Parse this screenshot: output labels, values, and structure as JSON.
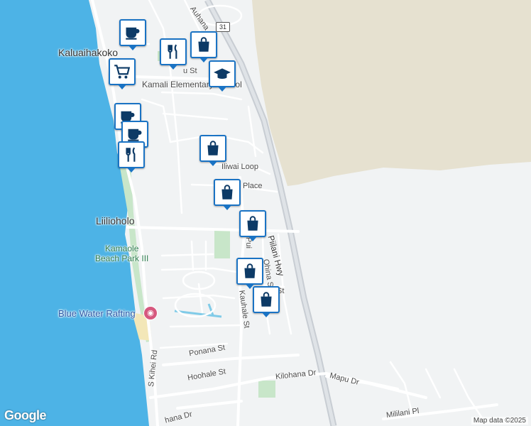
{
  "map": {
    "places": {
      "kaluaihakoko": "Kaluaihakoko",
      "liilioholo": "Liilioholo"
    },
    "poi": {
      "school": "Kamali  Elementary School",
      "park": "Kamaole\nBeach Park III",
      "rafting": "Blue Water Rafting"
    },
    "roads": {
      "auhana": "Auhana",
      "u_st": "u St",
      "iliwai": "Iliwai Loop",
      "place": "Place",
      "piilani": "Piilani Hwy",
      "pui": "Pui",
      "ohina": "Ohina St",
      "st": "St",
      "kauhale": "Kauhale St",
      "s_kihei": "S Kihei Rd",
      "ponana": "Ponana St",
      "hoohale": "Hoohale St",
      "kilohana": "Kilohana Dr",
      "mapu": "Mapu Dr",
      "mililani": "Mililani Pl",
      "bottom_dr": "hana Dr"
    },
    "route_shield": "31",
    "colors": {
      "water": "#4db3e6",
      "land": "#f1f3f4",
      "mountain": "#e6e1d0",
      "park": "#c8e6c9",
      "marker": "#1a73c4"
    }
  },
  "markers": [
    {
      "icon": "coffee-icon"
    },
    {
      "icon": "restaurant-icon"
    },
    {
      "icon": "shopping-bag-icon"
    },
    {
      "icon": "shopping-cart-icon"
    },
    {
      "icon": "school-icon"
    },
    {
      "icon": "coffee-icon"
    },
    {
      "icon": "coffee-icon"
    },
    {
      "icon": "restaurant-icon"
    },
    {
      "icon": "shopping-bag-icon"
    },
    {
      "icon": "shopping-bag-icon"
    },
    {
      "icon": "shopping-bag-icon"
    },
    {
      "icon": "shopping-bag-icon"
    },
    {
      "icon": "shopping-bag-icon"
    }
  ],
  "footer": {
    "logo": "Google",
    "attribution": "Map data ©2025"
  }
}
